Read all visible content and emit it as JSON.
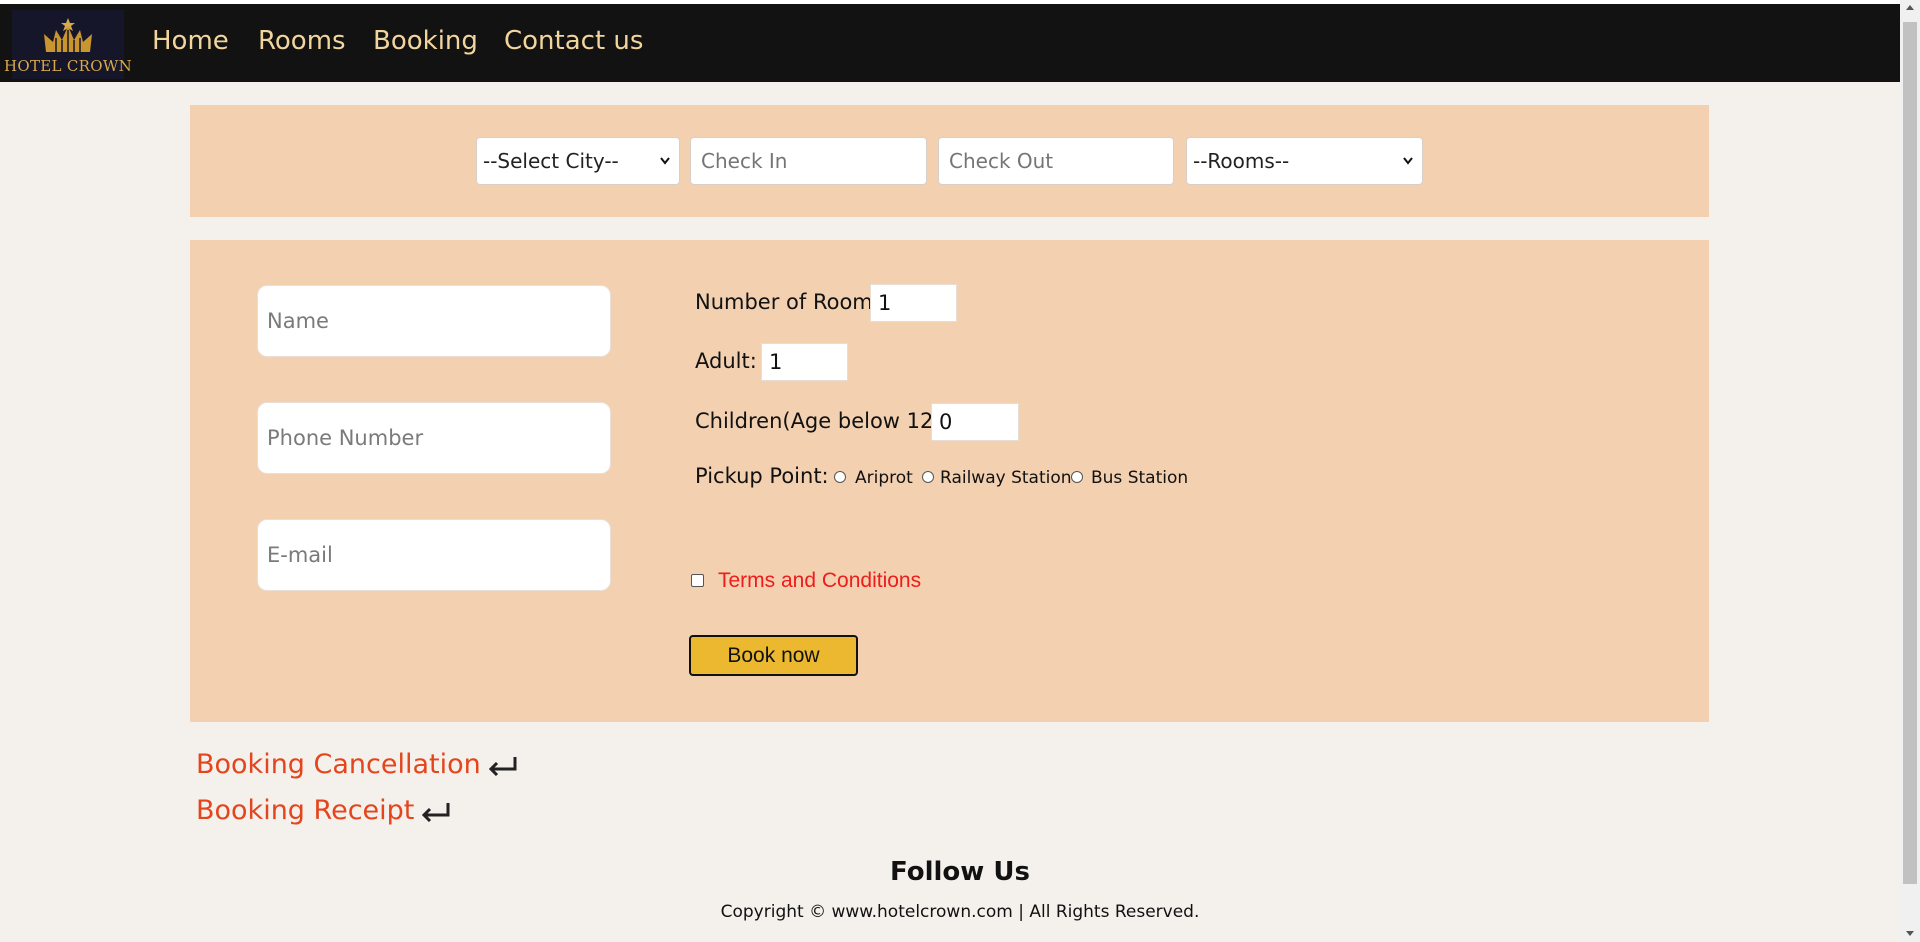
{
  "brand": {
    "logo_text": "HOTEL CROWN",
    "gold": "#d8a84a"
  },
  "nav": {
    "items": [
      {
        "label": "Home"
      },
      {
        "label": "Rooms"
      },
      {
        "label": "Booking"
      },
      {
        "label": "Contact us"
      }
    ],
    "color": "#f2d59d"
  },
  "search": {
    "city_select": "--Select City--",
    "check_in_placeholder": "Check In",
    "check_out_placeholder": "Check Out",
    "rooms_select": "--Rooms--"
  },
  "form": {
    "name_placeholder": "Name",
    "phone_placeholder": "Phone Number",
    "email_placeholder": "E-mail",
    "number_of_room_label": "Number of Room:",
    "number_of_room_value": "1",
    "adult_label": "Adult:",
    "adult_value": "1",
    "children_label": "Children(Age below 12):",
    "children_value": "0",
    "pickup_label": "Pickup Point:",
    "pickup_options": [
      "Ariprot",
      "Railway Station",
      "Bus Station"
    ],
    "terms_label": "Terms and Conditions",
    "terms_checked": false,
    "book_button": "Book now"
  },
  "links": {
    "cancellation": "Booking Cancellation",
    "receipt": "Booking Receipt",
    "icon": "return-arrow-icon"
  },
  "footer": {
    "follow": "Follow Us",
    "copyright": "Copyright © www.hotelcrown.com | All Rights Reserved."
  },
  "colors": {
    "panel": "#f2d0b0",
    "navbar": "#121212",
    "button": "#ebb830",
    "link": "#e4451c",
    "terms": "#ee1c1c"
  }
}
